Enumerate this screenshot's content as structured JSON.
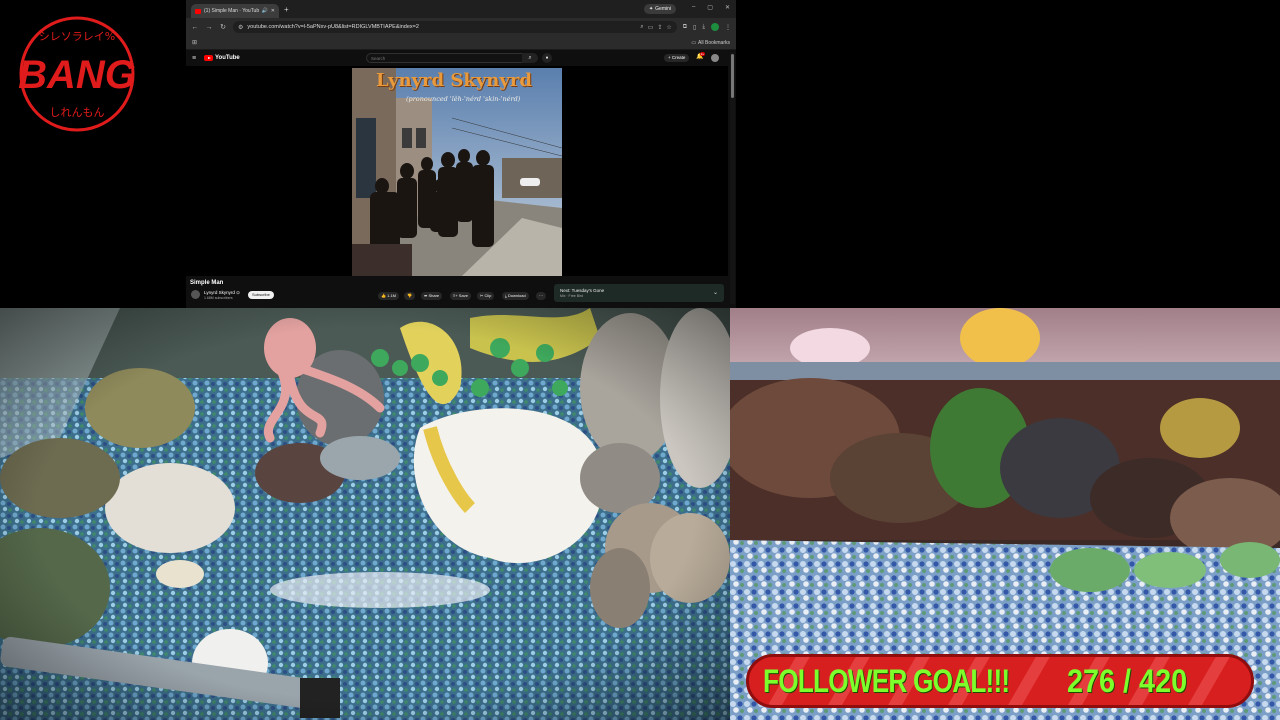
{
  "overlay": {
    "logo_text": "BANG",
    "logo_ring_text_top": "シレソラレイ%",
    "logo_ring_text_bottom": "しれんもん",
    "follower_goal_label": "FOLLOWER GOAL!!!",
    "follower_goal_current": 276,
    "follower_goal_target": 420,
    "follower_goal_display": "276 / 420"
  },
  "browser": {
    "tab_title": "(1) Simple Man · YouTube",
    "new_tab_symbol": "+",
    "gemini_label": "Gemini",
    "url": "youtube.com/watch?v=l-5aPNxv-pU8&list=RDIGLVMBTIAPE&index=2",
    "all_bookmarks_label": "All Bookmarks"
  },
  "youtube": {
    "logo_text": "YouTube",
    "search_placeholder": "Search",
    "create_label": "+ Create",
    "notification_count": "9+",
    "album": {
      "band_title": "Lynyrd Skynyrd",
      "subtitle": "(pronounced 'lĕh-'nérd 'skin-'nérd)"
    },
    "video": {
      "title": "Simple Man",
      "channel": "Lynyrd Skynyrd ⊙",
      "subscribers": "1.68M subscribers",
      "subscribe_label": "Subscribe",
      "likes": "1.1M",
      "share_label": "Share",
      "save_label": "Save",
      "clip_label": "Clip",
      "download_label": "Download",
      "more_label": "···"
    },
    "next_up": {
      "title": "Next: Tuesday's Gone",
      "subtitle": "Mix · Free Bird"
    }
  },
  "colors": {
    "goal_bar": "#d81f1f",
    "goal_text": "#7dff2b",
    "logo_red": "#e01b1b",
    "youtube_red": "#ff0000"
  }
}
